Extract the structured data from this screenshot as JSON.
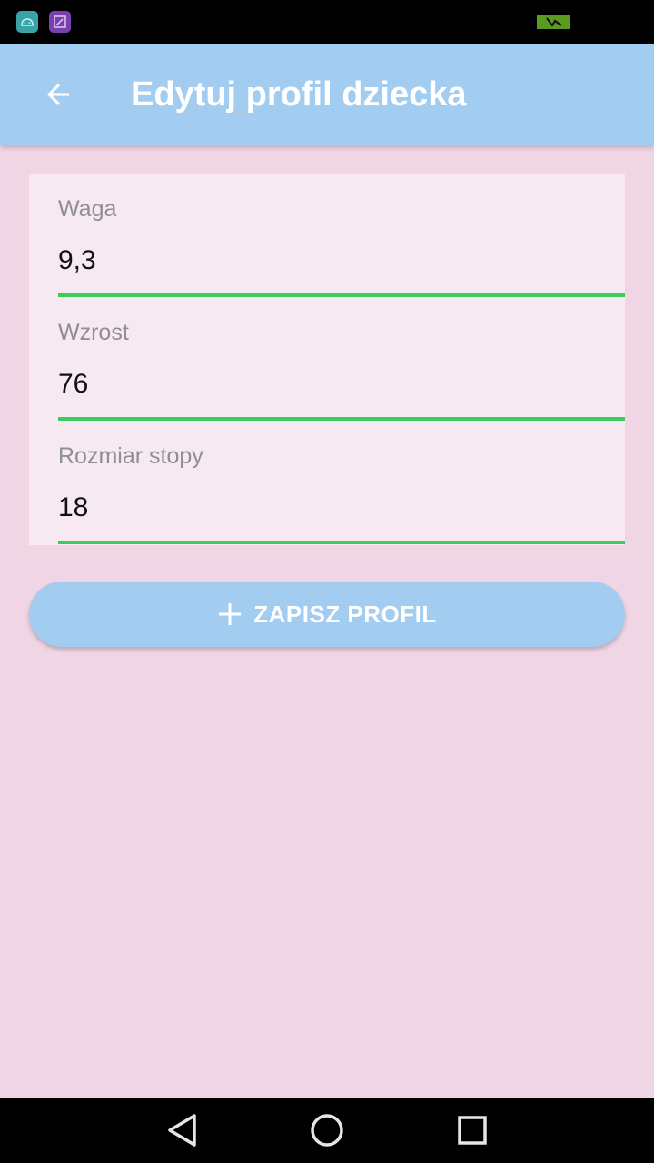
{
  "status_bar": {
    "icons": [
      "android-icon",
      "gallery-icon",
      "battery-icon"
    ]
  },
  "app_bar": {
    "title": "Edytuj profil dziecka",
    "back_icon": "arrow-back-icon",
    "background_color": "#a3cdf0"
  },
  "form": {
    "fields": [
      {
        "label": "Waga",
        "value": "9,3"
      },
      {
        "label": "Wzrost",
        "value": "76"
      },
      {
        "label": "Rozmiar stopy",
        "value": "18"
      }
    ],
    "underline_color": "#3dcc5c"
  },
  "save_button": {
    "label": "ZAPISZ PROFIL",
    "icon": "plus-icon"
  },
  "nav_bar": {
    "buttons": [
      "back-triangle-icon",
      "home-circle-icon",
      "recents-square-icon"
    ]
  },
  "colors": {
    "page_background": "#f0d6e5",
    "card_background": "#f7e9f1"
  }
}
